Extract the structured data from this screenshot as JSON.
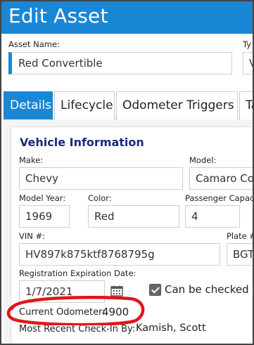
{
  "window": {
    "title": "Edit Asset"
  },
  "asset": {
    "name_label": "Asset Name:",
    "name_value": "Red Convertible",
    "type_label": "Ty",
    "type_value": "V"
  },
  "tabs": [
    {
      "label": "Details",
      "active": true
    },
    {
      "label": "Lifecycle",
      "active": false
    },
    {
      "label": "Odometer Triggers",
      "active": false
    },
    {
      "label": "Ta",
      "active": false
    }
  ],
  "vehicle": {
    "section_title": "Vehicle Information",
    "make_label": "Make:",
    "make_value": "Chevy",
    "model_label": "Model:",
    "model_value": "Camaro Co",
    "year_label": "Model Year:",
    "year_value": "1969",
    "color_label": "Color:",
    "color_value": "Red",
    "capacity_label": "Passenger Capac",
    "capacity_value": "4",
    "vin_label": "VIN #:",
    "vin_value": "HV897k875ktf8768795g",
    "plate_label": "Plate #",
    "plate_value": "BGT",
    "reg_label": "Registration Expiration Date:",
    "reg_value": "1/7/2021",
    "checkout_label": "Can be checked o",
    "odometer_label": "Current Odometer:",
    "odometer_value": "4900",
    "checkin_label": "Most Recent Check-In By:",
    "checkin_value": "Kamish, Scott"
  },
  "colors": {
    "accent": "#1a86d6",
    "section_title": "#1d2a7a",
    "annotation": "#e0161c"
  },
  "icons": {
    "calendar": "calendar-icon",
    "checkbox": "checkbox-checked-icon"
  }
}
